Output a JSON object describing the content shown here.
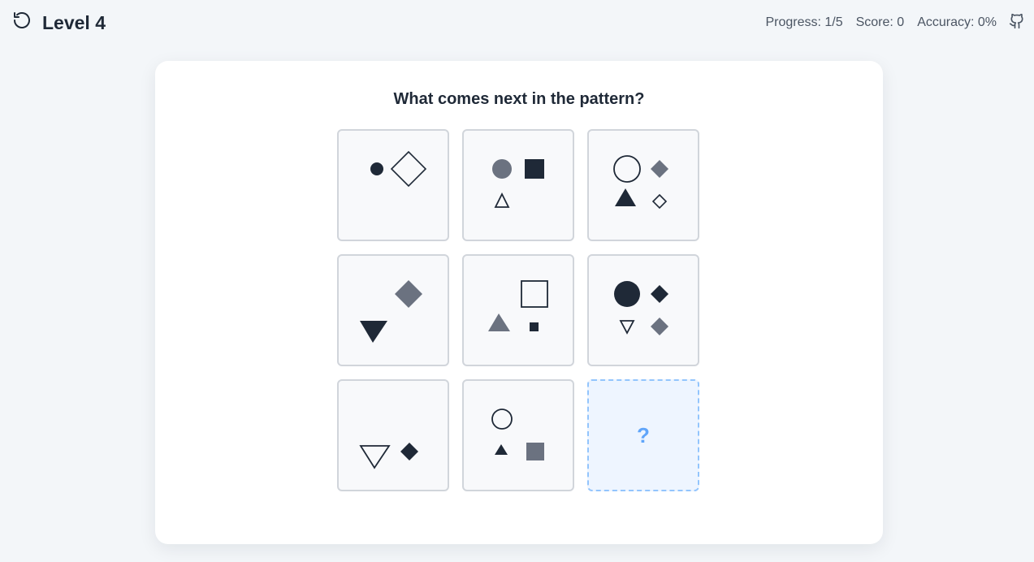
{
  "header": {
    "reset_icon": "rotate-ccw-icon",
    "level_title": "Level 4",
    "progress": "Progress: 1/5",
    "score": "Score: 0",
    "accuracy": "Accuracy: 0%",
    "github_icon": "github-icon"
  },
  "puzzle": {
    "question": "What comes next in the pattern?",
    "answer_placeholder": "?"
  },
  "colors": {
    "dark": "#1f2937",
    "gray": "#6b7280",
    "answer_border": "#93c5fd",
    "answer_bg": "#eef5ff",
    "answer_text": "#60a5fa"
  }
}
